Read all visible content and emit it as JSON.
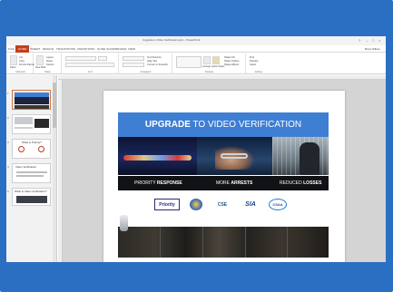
{
  "window": {
    "title": "Upgrade to Video Verification.pptx - PowerPoint",
    "controls": [
      "?",
      "–",
      "□",
      "×"
    ]
  },
  "ribbon_tabs": [
    "FILE",
    "HOME",
    "INSERT",
    "DESIGN",
    "TRANSITIONS",
    "ANIMATIONS",
    "SLIDE SHOW",
    "REVIEW",
    "VIEW"
  ],
  "active_tab": "HOME",
  "user": "Brent Wilson",
  "ribbon": {
    "groups": [
      "Clipboard",
      "Slides",
      "Font",
      "Paragraph",
      "Drawing",
      "Editing"
    ],
    "buttons": {
      "paste": "Paste",
      "cut": "Cut",
      "copy": "Copy",
      "format_painter": "Format Painter",
      "new_slide": "New Slide",
      "layout": "Layout",
      "reset": "Reset",
      "section": "Section",
      "text_direction": "Text Direction",
      "align_text": "Align Text",
      "convert_smartart": "Convert to SmartArt",
      "arrange": "Arrange",
      "quick_styles": "Quick Styles",
      "shape_fill": "Shape Fill",
      "shape_outline": "Shape Outline",
      "shape_effects": "Shape Effects",
      "find": "Find",
      "replace": "Replace",
      "select": "Select"
    }
  },
  "thumbnails": [
    {
      "num": "1",
      "text": ""
    },
    {
      "num": "2",
      "text": ""
    },
    {
      "num": "3",
      "text": "What is Priority?"
    },
    {
      "num": "4",
      "text": "Video Verification"
    },
    {
      "num": "5",
      "text": "What is Video Verification?"
    }
  ],
  "slide": {
    "headline_bold": "UPGRADE",
    "headline_rest": "TO VIDEO VERIFICATION",
    "captions": [
      {
        "plain": "PRIORITY ",
        "accent": "RESPONSE"
      },
      {
        "plain": "MORE ",
        "accent": "ARRESTS"
      },
      {
        "plain": "REDUCED ",
        "accent": "LOSSES"
      }
    ],
    "logos": {
      "priority": "Priority",
      "cse": "CSE",
      "sia": "SIA",
      "csaa": "CSAA"
    }
  },
  "colors": {
    "frame": "#2b6fc2",
    "accent_tab": "#c43e1c",
    "banner_blue": "#3f7fd3",
    "caption_accent": "#6ea3ff"
  }
}
